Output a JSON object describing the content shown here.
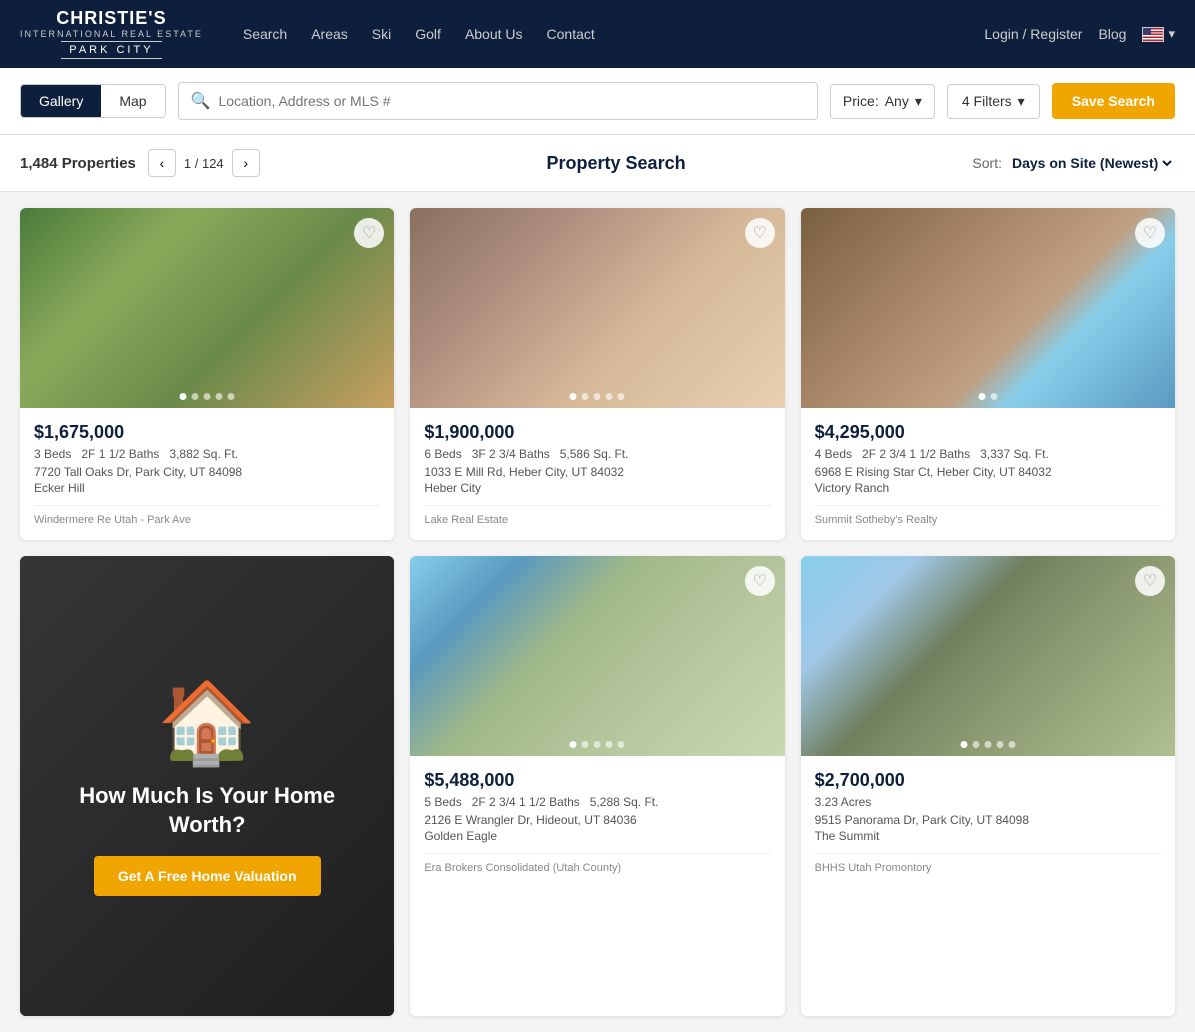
{
  "site": {
    "brand_top": "CHRISTIE'S",
    "brand_sub": "INTERNATIONAL REAL ESTATE",
    "brand_city": "PARK CITY"
  },
  "navbar": {
    "links": [
      "Search",
      "Areas",
      "Ski",
      "Golf",
      "About Us",
      "Contact"
    ],
    "right": {
      "login": "Login / Register",
      "blog": "Blog"
    }
  },
  "search_bar": {
    "gallery_label": "Gallery",
    "map_label": "Map",
    "search_placeholder": "Location, Address or MLS #",
    "price_label": "Price:",
    "price_value": "Any",
    "filters_label": "4 Filters",
    "save_search_label": "Save Search"
  },
  "results": {
    "count": "1,484 Properties",
    "page": "1 / 124",
    "title": "Property Search",
    "sort_label": "Sort:",
    "sort_value": "Days on Site (Newest)"
  },
  "properties": [
    {
      "price": "$1,675,000",
      "beds": "3 Beds",
      "baths": "2F  1 1/2 Baths",
      "sqft": "3,882 Sq. Ft.",
      "address": "7720 Tall Oaks Dr, Park City, UT 84098",
      "community": "Ecker Hill",
      "agent": "Windermere Re Utah - Park Ave",
      "dots": 5,
      "img_class": "img-house1"
    },
    {
      "price": "$1,900,000",
      "beds": "6 Beds",
      "baths": "3F  2 3/4 Baths",
      "sqft": "5,586 Sq. Ft.",
      "address": "1033 E Mill Rd, Heber City, UT 84032",
      "community": "Heber City",
      "agent": "Lake Real Estate",
      "dots": 5,
      "img_class": "img-house2"
    },
    {
      "price": "$4,295,000",
      "beds": "4 Beds",
      "baths": "2F  2 3/4  1 1/2 Baths",
      "sqft": "3,337 Sq. Ft.",
      "address": "6968 E Rising Star Ct, Heber City, UT 84032",
      "community": "Victory Ranch",
      "agent": "Summit Sotheby's Realty",
      "dots": 2,
      "img_class": "img-house3"
    },
    {
      "price": "$5,488,000",
      "beds": "5 Beds",
      "baths": "2F  2 3/4  1 1/2 Baths",
      "sqft": "5,288 Sq. Ft.",
      "address": "2126 E Wrangler Dr, Hideout, UT 84036",
      "community": "Golden Eagle",
      "agent": "Era Brokers Consolidated (Utah County)",
      "dots": 5,
      "img_class": "img-house4"
    },
    {
      "price": "$2,700,000",
      "beds": "",
      "baths": "",
      "sqft": "",
      "acreage": "3.23 Acres",
      "address": "9515 Panorama Dr, Park City, UT 84098",
      "community": "The Summit",
      "agent": "BHHS Utah Promontory",
      "dots": 5,
      "img_class": "img-house5"
    }
  ],
  "promo": {
    "title": "How Much Is Your Home Worth?",
    "cta": "Get A Free Home Valuation"
  }
}
